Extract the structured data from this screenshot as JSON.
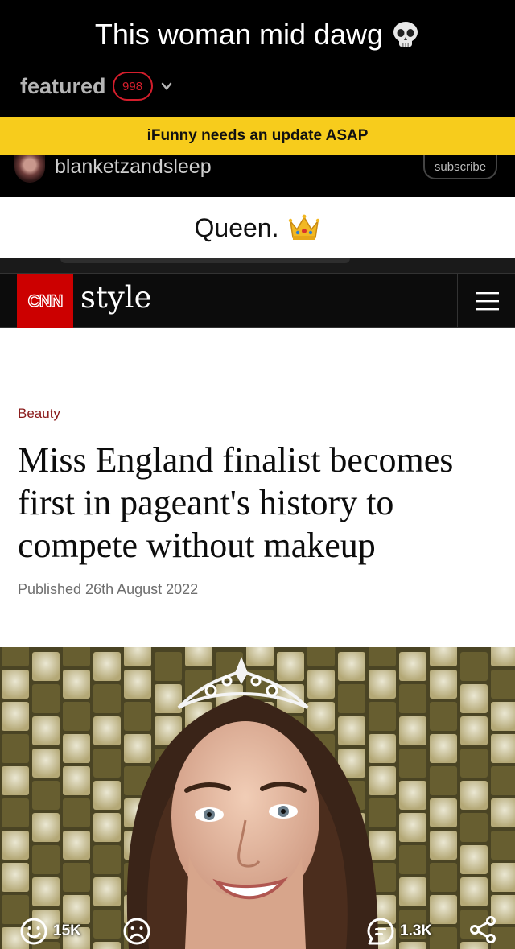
{
  "post": {
    "title": "This woman mid dawg",
    "title_emoji": "skull-emoji"
  },
  "feed": {
    "label": "featured",
    "count": "998"
  },
  "banner": {
    "text": "iFunny needs an update ASAP",
    "color": "#f7cc1c"
  },
  "author": {
    "username": "blanketzandsleep",
    "subscribe_label": "subscribe"
  },
  "caption": {
    "text": "Queen.",
    "emoji": "crown-emoji"
  },
  "cnn": {
    "logo": "CNN",
    "section": "style",
    "brand_color": "#cc0000"
  },
  "article": {
    "kicker": "Beauty",
    "headline": "Miss England finalist becomes first in pageant's history to compete without makeup",
    "published": "Published 26th August 2022"
  },
  "actions": {
    "smile_count": "15K",
    "comments_count": "1.3K"
  }
}
